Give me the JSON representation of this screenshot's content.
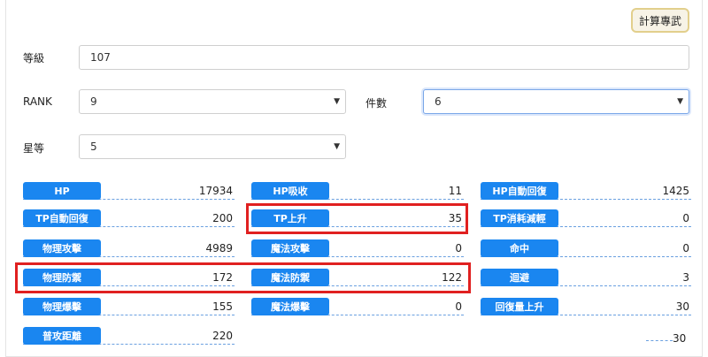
{
  "toolbar": {
    "calc_label": "計算專武"
  },
  "form": {
    "level": {
      "label": "等級",
      "value": "107"
    },
    "rank": {
      "label": "RANK",
      "value": "9"
    },
    "pieces": {
      "label": "件數",
      "value": "6"
    },
    "stars": {
      "label": "星等",
      "value": "5"
    }
  },
  "stats": [
    {
      "name": "HP",
      "value": "17934"
    },
    {
      "name": "HP吸收",
      "value": "11"
    },
    {
      "name": "HP自動回復",
      "value": "1425"
    },
    {
      "name": "TP自動回復",
      "value": "200"
    },
    {
      "name": "TP上升",
      "value": "35"
    },
    {
      "name": "TP消耗減輕",
      "value": "0"
    },
    {
      "name": "物理攻擊",
      "value": "4989"
    },
    {
      "name": "魔法攻擊",
      "value": "0"
    },
    {
      "name": "命中",
      "value": "0"
    },
    {
      "name": "物理防禦",
      "value": "172"
    },
    {
      "name": "魔法防禦",
      "value": "122"
    },
    {
      "name": "迴避",
      "value": "3"
    },
    {
      "name": "物理爆擊",
      "value": "155"
    },
    {
      "name": "魔法爆擊",
      "value": "0"
    },
    {
      "name": "回復量上升",
      "value": "30"
    },
    {
      "name": "普攻距離",
      "value": "220"
    }
  ],
  "fragment": {
    "value": "30"
  }
}
